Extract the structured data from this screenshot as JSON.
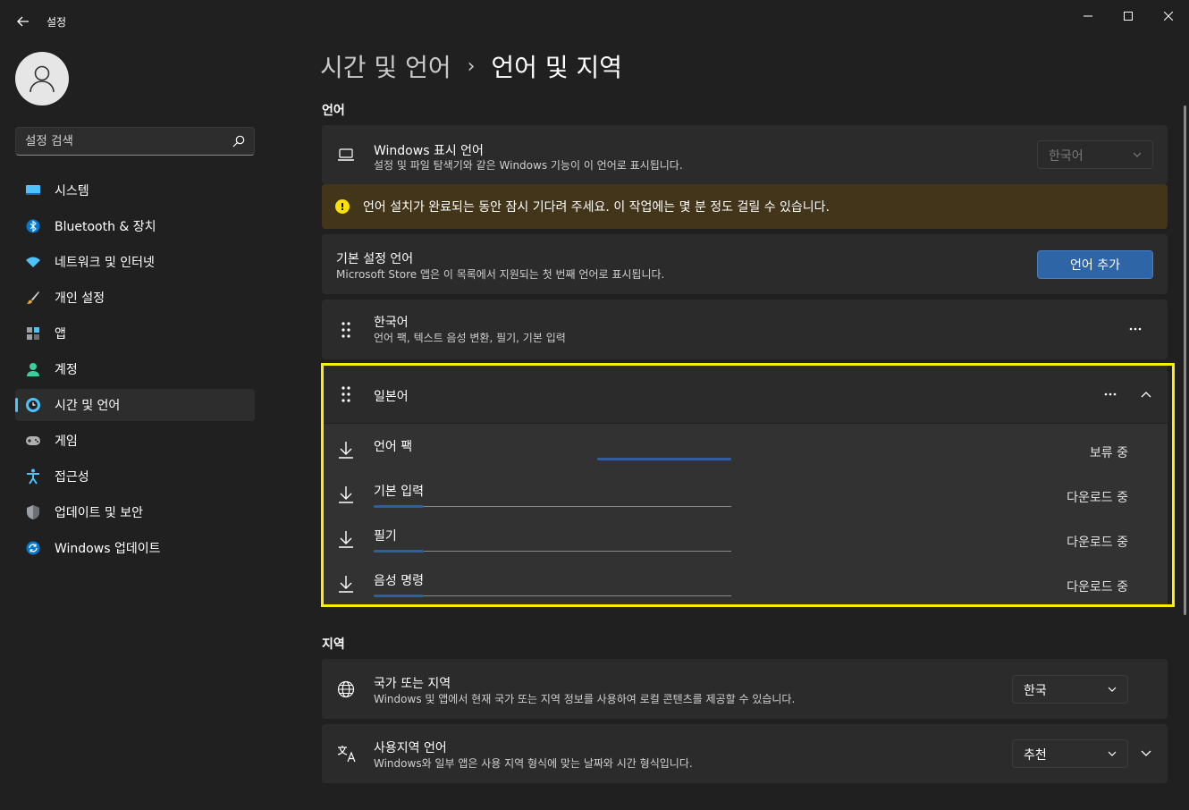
{
  "window": {
    "title": "설정",
    "controls": [
      "minimize-icon",
      "maximize-icon",
      "close-icon"
    ]
  },
  "sidebar": {
    "search_placeholder": "설정 검색",
    "items": [
      {
        "label": "시스템",
        "icon": "system-icon",
        "color": "#4cc2ff"
      },
      {
        "label": "Bluetooth & 장치",
        "icon": "bluetooth-icon",
        "color": "#0078d4"
      },
      {
        "label": "네트워크 및 인터넷",
        "icon": "wifi-icon",
        "color": "#4cc2ff"
      },
      {
        "label": "개인 설정",
        "icon": "brush-icon",
        "color": "#e8a33a"
      },
      {
        "label": "앱",
        "icon": "apps-icon",
        "color": "#9aa0a6"
      },
      {
        "label": "계정",
        "icon": "account-icon",
        "color": "#3ccf9b"
      },
      {
        "label": "시간 및 언어",
        "icon": "time-language-icon",
        "color": "#4cc2ff",
        "active": true
      },
      {
        "label": "게임",
        "icon": "gamepad-icon",
        "color": "#b0b0b0"
      },
      {
        "label": "접근성",
        "icon": "accessibility-icon",
        "color": "#4cc2ff"
      },
      {
        "label": "업데이트 및 보안",
        "icon": "shield-icon",
        "color": "#9aa0a6"
      },
      {
        "label": "Windows 업데이트",
        "icon": "windows-update-icon",
        "color": "#0078d4"
      }
    ]
  },
  "breadcrumb": {
    "parent": "시간 및 언어",
    "separator": "›",
    "current": "언어 및 지역"
  },
  "language_section": {
    "title": "언어",
    "display_language": {
      "title": "Windows 표시 언어",
      "subtitle": "설정 및 파일 탐색기와 같은 Windows 기능이 이 언어로 표시됩니다.",
      "value": "한국어"
    },
    "warning": {
      "text": "언어 설치가 완료되는 동안 잠시 기다려 주세요. 이 작업에는 몇 분 정도 걸릴 수 있습니다.",
      "color": "#fce100"
    },
    "preferred": {
      "title": "기본 설정 언어",
      "subtitle": "Microsoft Store 앱은 이 목록에서 지원되는 첫 번째 언어로 표시됩니다.",
      "add_button": "언어 추가"
    },
    "languages": [
      {
        "name": "한국어",
        "detail": "언어 팩, 텍스트 음성 변환, 필기, 기본 입력"
      },
      {
        "name": "일본어",
        "detail": ""
      }
    ],
    "downloads": [
      {
        "label": "언어 팩",
        "status": "보류 중",
        "progress": 0
      },
      {
        "label": "기본 입력",
        "status": "다운로드 중",
        "progress": 0.14
      },
      {
        "label": "필기",
        "status": "다운로드 중",
        "progress": 0.14
      },
      {
        "label": "음성 명령",
        "status": "다운로드 중",
        "progress": 0.14
      }
    ]
  },
  "region_section": {
    "title": "지역",
    "country": {
      "title": "국가 또는 지역",
      "subtitle": "Windows 및 앱에서 현재 국가 또는 지역 정보를 사용하여 로컬 콘텐츠를 제공할 수 있습니다.",
      "value": "한국"
    },
    "regional_format": {
      "title": "사용지역 언어",
      "subtitle": "Windows와 일부 앱은 사용 지역 형식에 맞는 날짜와 시간 형식입니다.",
      "value": "추천"
    }
  },
  "accent_color": "#2e65a6",
  "highlight_color": "#ffee00"
}
